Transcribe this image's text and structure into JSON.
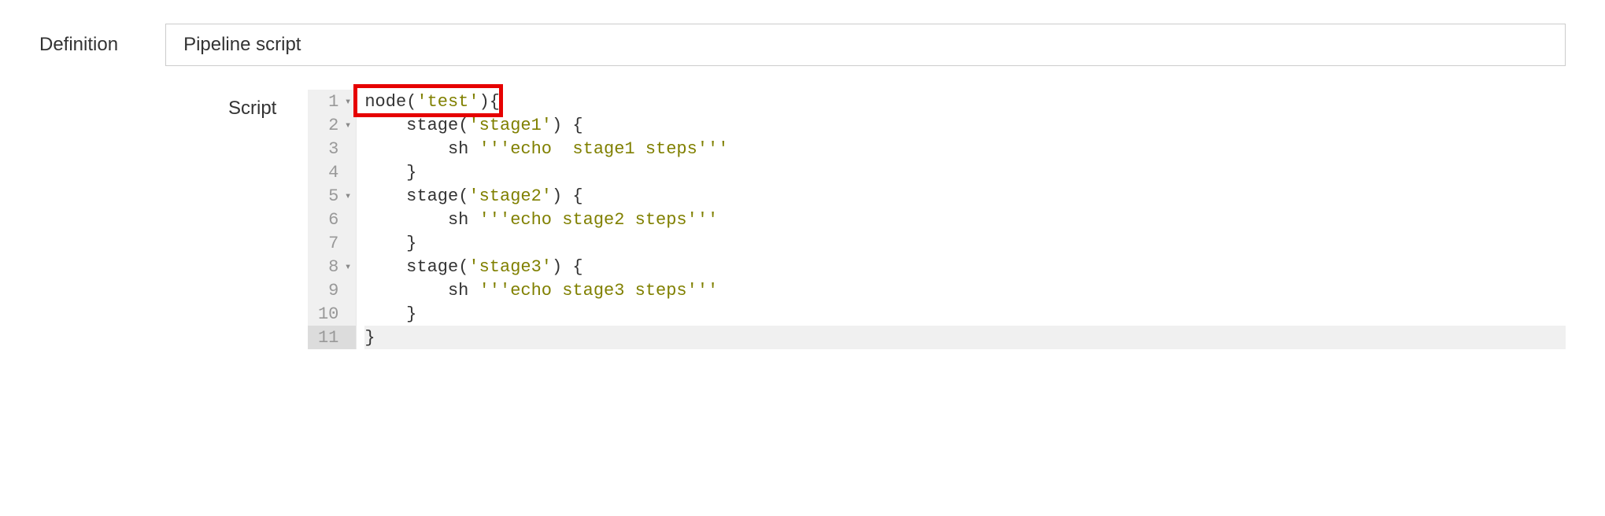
{
  "definition": {
    "label": "Definition",
    "selected": "Pipeline script"
  },
  "script": {
    "label": "Script"
  },
  "editor": {
    "lines": [
      {
        "num": "1",
        "fold": true,
        "active": false
      },
      {
        "num": "2",
        "fold": true,
        "active": false
      },
      {
        "num": "3",
        "fold": false,
        "active": false
      },
      {
        "num": "4",
        "fold": false,
        "active": false
      },
      {
        "num": "5",
        "fold": true,
        "active": false
      },
      {
        "num": "6",
        "fold": false,
        "active": false
      },
      {
        "num": "7",
        "fold": false,
        "active": false
      },
      {
        "num": "8",
        "fold": true,
        "active": false
      },
      {
        "num": "9",
        "fold": false,
        "active": false
      },
      {
        "num": "10",
        "fold": false,
        "active": false
      },
      {
        "num": "11",
        "fold": false,
        "active": true
      }
    ],
    "code": {
      "l1_node": "node",
      "l1_arg": "'test'",
      "l2_stage": "stage",
      "l2_arg": "'stage1'",
      "l3_sh": "sh",
      "l3_str": "'''echo  stage1 steps'''",
      "l5_stage": "stage",
      "l5_arg": "'stage2'",
      "l6_sh": "sh",
      "l6_str": "'''echo stage2 steps'''",
      "l8_stage": "stage",
      "l8_arg": "'stage3'",
      "l9_sh": "sh",
      "l9_str": "'''echo stage3 steps'''",
      "open_paren": "(",
      "close_paren": ")",
      "open_brace": "{",
      "close_brace": "}"
    }
  }
}
